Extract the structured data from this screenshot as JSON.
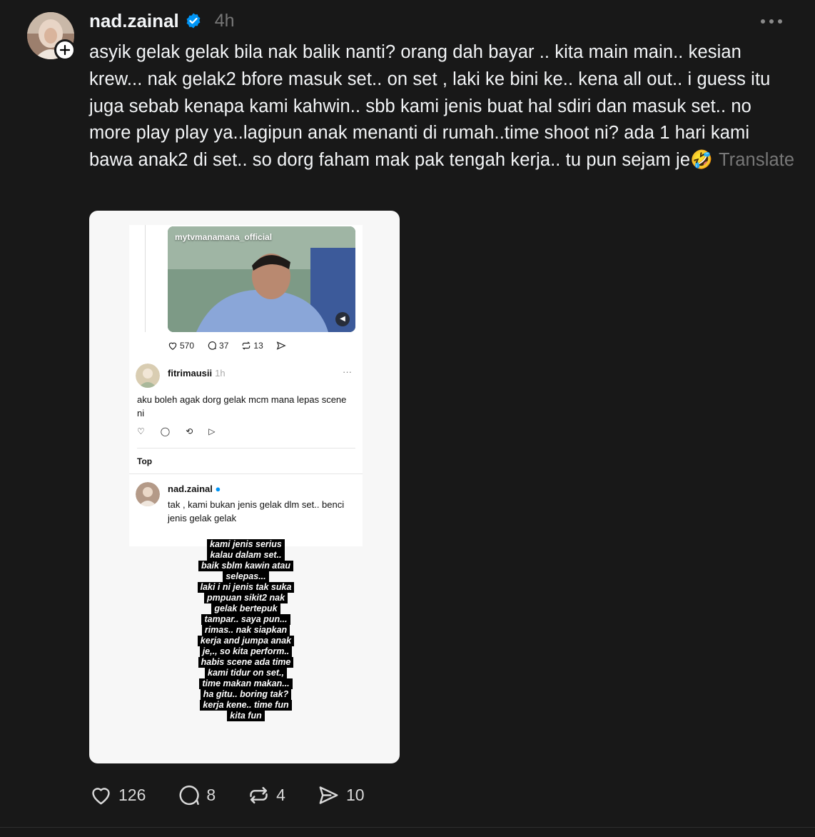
{
  "post": {
    "username": "nad.zainal",
    "time": "4h",
    "caption": "asyik gelak gelak bila nak balik nanti? orang dah bayar .. kita main main.. kesian krew... nak gelak2 bfore masuk set.. on set , laki ke bini ke.. kena all out.. i guess itu juga sebab kenapa kami kahwin.. sbb kami jenis buat hal sdiri dan masuk set.. no more play play ya..lagipun anak menanti di rumah..time shoot ni? ada 1 hari kami bawa anak2 di set.. so dorg faham mak pak tengah kerja.. tu pun sejam je🤣",
    "translate_label": "Translate",
    "likes": "126",
    "comments": "8",
    "reposts": "4",
    "shares": "10"
  },
  "screenshot": {
    "video_tag": "mytvmanamana_official",
    "likes": "570",
    "comments": "37",
    "reposts": "13",
    "reply1": {
      "username": "fitrimausii",
      "time": "1h",
      "text": "aku boleh agak dorg gelak mcm mana lepas scene ni"
    },
    "sort_label": "Top",
    "reply2": {
      "username": "nad.zainal",
      "text": "tak , kami bukan jenis gelak dlm set.. benci jenis gelak gelak"
    },
    "story_lines": [
      "kami jenis serius",
      "kalau dalam set..",
      "baik sblm kawin atau",
      "selepas...",
      "laki i ni jenis tak suka",
      "pmpuan sikit2 nak",
      "gelak bertepuk",
      "tampar.. saya pun...",
      "rimas.. nak siapkan",
      "kerja and jumpa anak",
      "je,., so kita perform..",
      "habis scene ada time",
      "kami tidur on set.,",
      "time makan makan...",
      "ha gitu.. boring tak?",
      "kerja kene.. time fun",
      "kita fun"
    ]
  },
  "colors": {
    "background": "#181818",
    "text": "#f3f5f7",
    "muted": "#777777",
    "verified": "#0095f6"
  }
}
